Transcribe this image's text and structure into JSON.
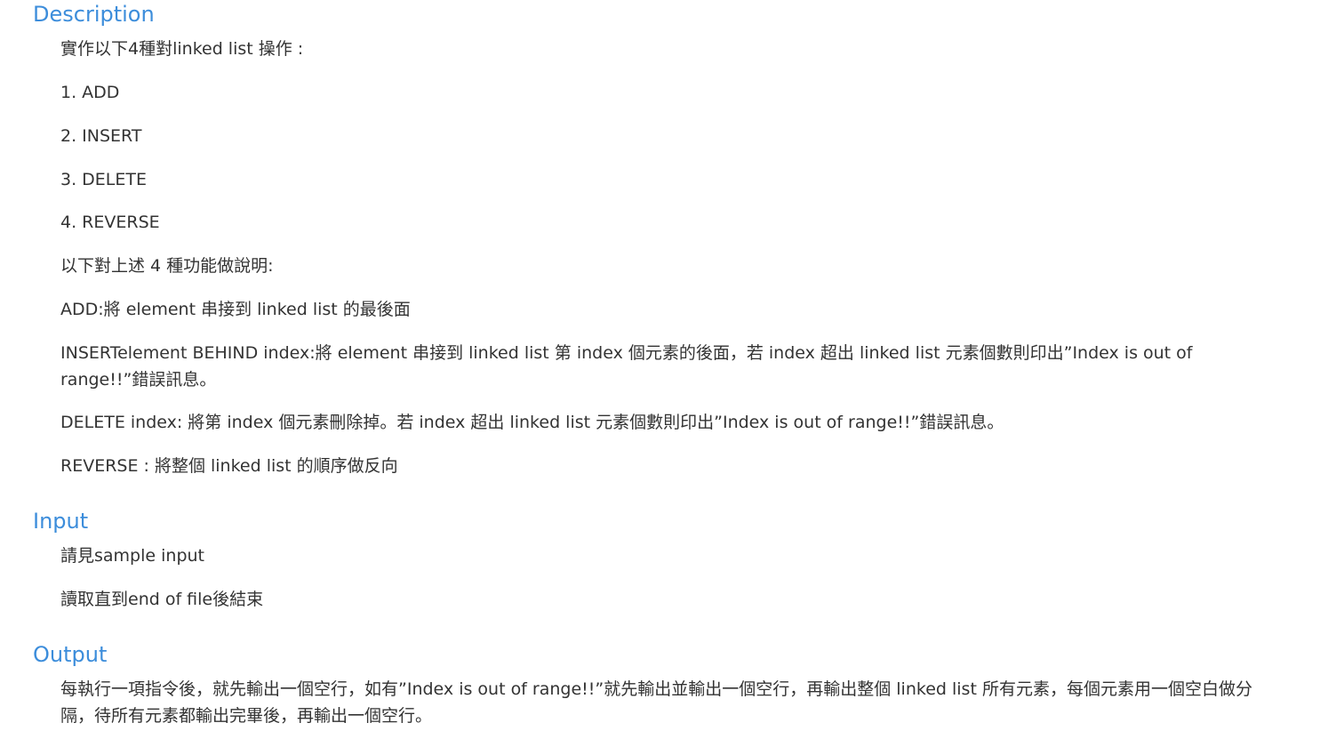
{
  "description": {
    "title": "Description",
    "intro": "實作以下4種對linked list 操作 :",
    "items": [
      "1. ADD",
      "2. INSERT",
      "3. DELETE",
      "4. REVERSE"
    ],
    "explain_heading": "以下對上述 4 種功能做說明:",
    "add": "ADD:將 element 串接到 linked list 的最後面",
    "insert": "INSERTelement BEHIND index:將 element 串接到 linked list 第 index 個元素的後面，若 index 超出 linked list 元素個數則印出”Index is out of range!!”錯誤訊息。",
    "delete": "DELETE index: 將第 index 個元素刪除掉。若 index 超出 linked list 元素個數則印出”Index is out of range!!”錯誤訊息。",
    "reverse": "REVERSE : 將整個 linked list 的順序做反向"
  },
  "input": {
    "title": "Input",
    "line1": "請見sample input",
    "line2": "讀取直到end of file後結束"
  },
  "output": {
    "title": "Output",
    "line1": "每執行一項指令後，就先輸出一個空行，如有”Index is out of range!!”就先輸出並輸出一個空行，再輸出整個 linked list 所有元素，每個元素用一個空白做分隔，待所有元素都輸出完畢後，再輸出一個空行。"
  }
}
